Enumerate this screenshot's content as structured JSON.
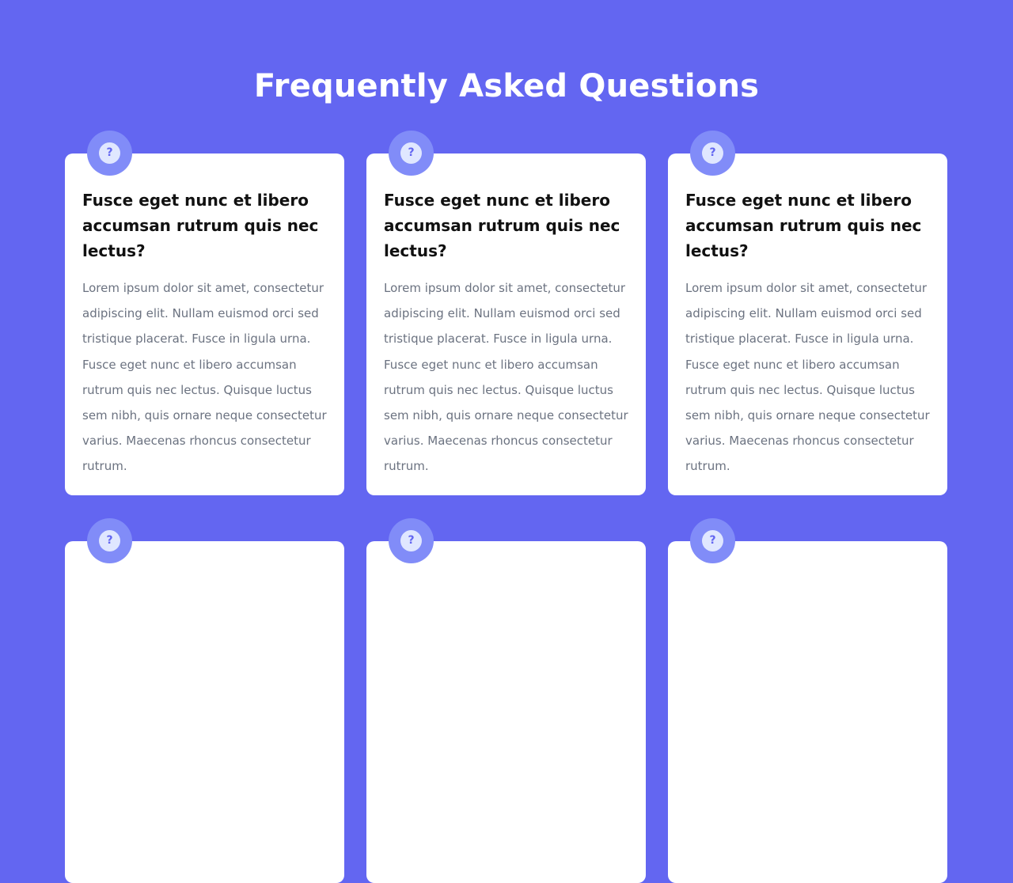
{
  "page": {
    "title": "Frequently Asked Questions"
  },
  "icons": {
    "badge": "question-mark-icon",
    "badge_glyph": "?"
  },
  "colors": {
    "background": "#6366f1",
    "card": "#ffffff",
    "badge_ring": "#818cf8",
    "badge_inner": "#e0e7ff",
    "question_text": "#111111",
    "answer_text": "#6b7280"
  },
  "faq": [
    {
      "question": "Fusce eget nunc et libero accumsan rutrum quis nec lectus?",
      "answer": "Lorem ipsum dolor sit amet, consectetur adipiscing elit. Nullam euismod orci sed tristique placerat. Fusce in ligula urna. Fusce eget nunc et libero accumsan rutrum quis nec lectus. Quisque luctus sem nibh, quis ornare neque consectetur varius. Maecenas rhoncus consectetur rutrum."
    },
    {
      "question": "Fusce eget nunc et libero accumsan rutrum quis nec lectus?",
      "answer": "Lorem ipsum dolor sit amet, consectetur adipiscing elit. Nullam euismod orci sed tristique placerat. Fusce in ligula urna. Fusce eget nunc et libero accumsan rutrum quis nec lectus. Quisque luctus sem nibh, quis ornare neque consectetur varius. Maecenas rhoncus consectetur rutrum."
    },
    {
      "question": "Fusce eget nunc et libero accumsan rutrum quis nec lectus?",
      "answer": "Lorem ipsum dolor sit amet, consectetur adipiscing elit. Nullam euismod orci sed tristique placerat. Fusce in ligula urna. Fusce eget nunc et libero accumsan rutrum quis nec lectus. Quisque luctus sem nibh, quis ornare neque consectetur varius. Maecenas rhoncus consectetur rutrum."
    },
    {
      "question": "",
      "answer": ""
    },
    {
      "question": "",
      "answer": ""
    },
    {
      "question": "",
      "answer": ""
    }
  ]
}
